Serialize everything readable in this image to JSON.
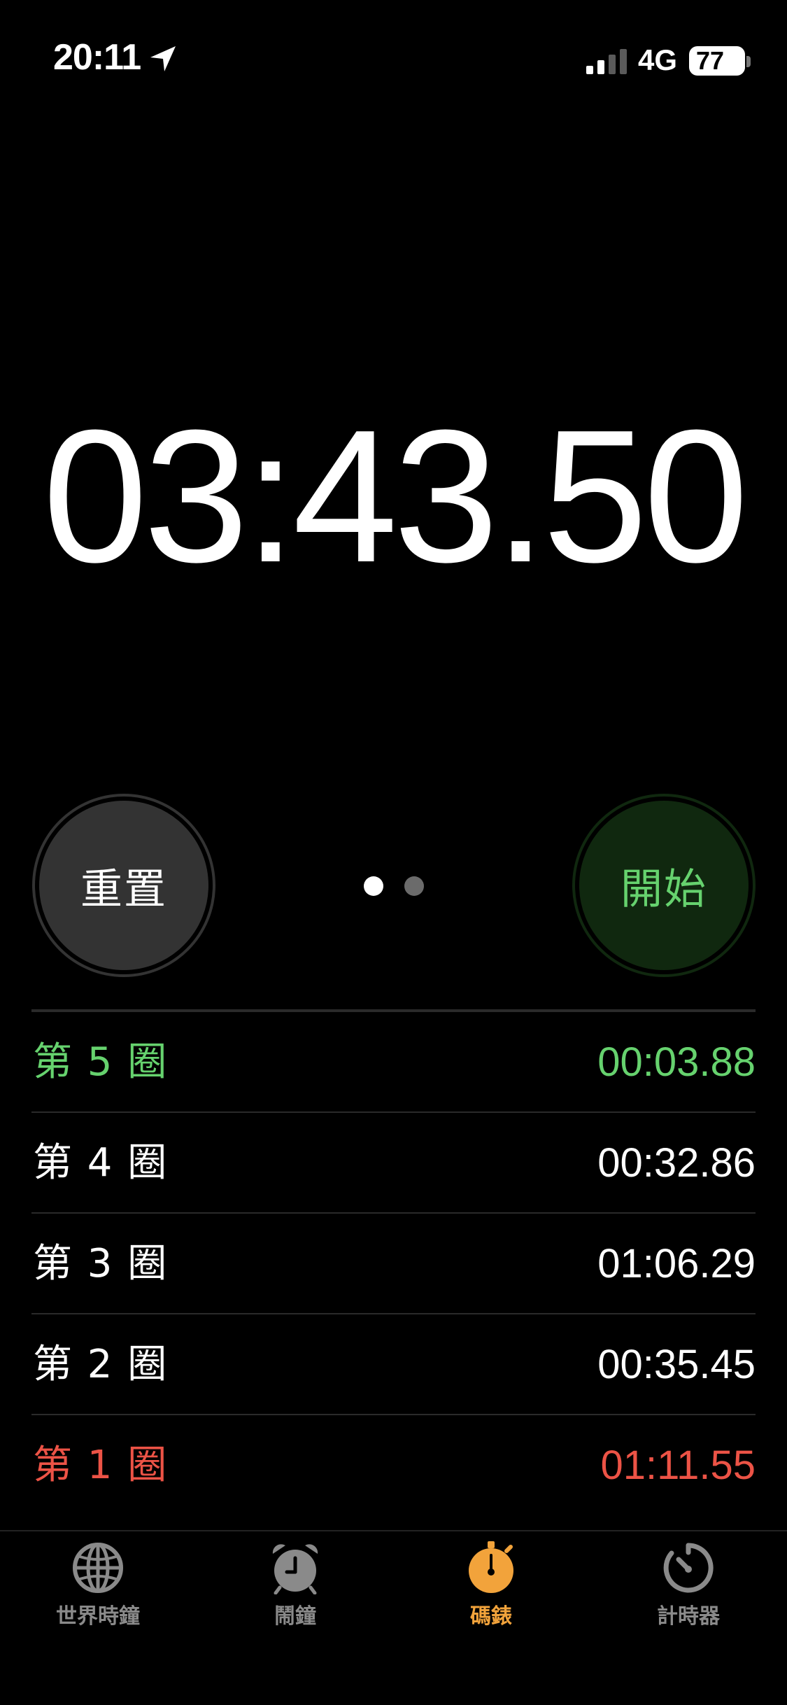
{
  "status_bar": {
    "time": "20:11",
    "network": "4G",
    "battery": "77"
  },
  "stopwatch": {
    "display": "03:43.50"
  },
  "buttons": {
    "reset": "重置",
    "start": "開始"
  },
  "laps": [
    {
      "label": "第 5 圈",
      "time": "00:03.88",
      "status": "fastest"
    },
    {
      "label": "第 4 圈",
      "time": "00:32.86",
      "status": "normal"
    },
    {
      "label": "第 3 圈",
      "time": "01:06.29",
      "status": "normal"
    },
    {
      "label": "第 2 圈",
      "time": "00:35.45",
      "status": "normal"
    },
    {
      "label": "第 1 圈",
      "time": "01:11.55",
      "status": "slowest"
    }
  ],
  "tabs": [
    {
      "label": "世界時鐘",
      "icon": "globe-icon",
      "active": false
    },
    {
      "label": "鬧鐘",
      "icon": "alarm-clock-icon",
      "active": false
    },
    {
      "label": "碼錶",
      "icon": "stopwatch-icon",
      "active": true
    },
    {
      "label": "計時器",
      "icon": "timer-icon",
      "active": false
    }
  ],
  "colors": {
    "fastest": "#66d26e",
    "slowest": "#ec5346",
    "accent": "#f2a33b",
    "inactive": "#8a8a8a"
  }
}
